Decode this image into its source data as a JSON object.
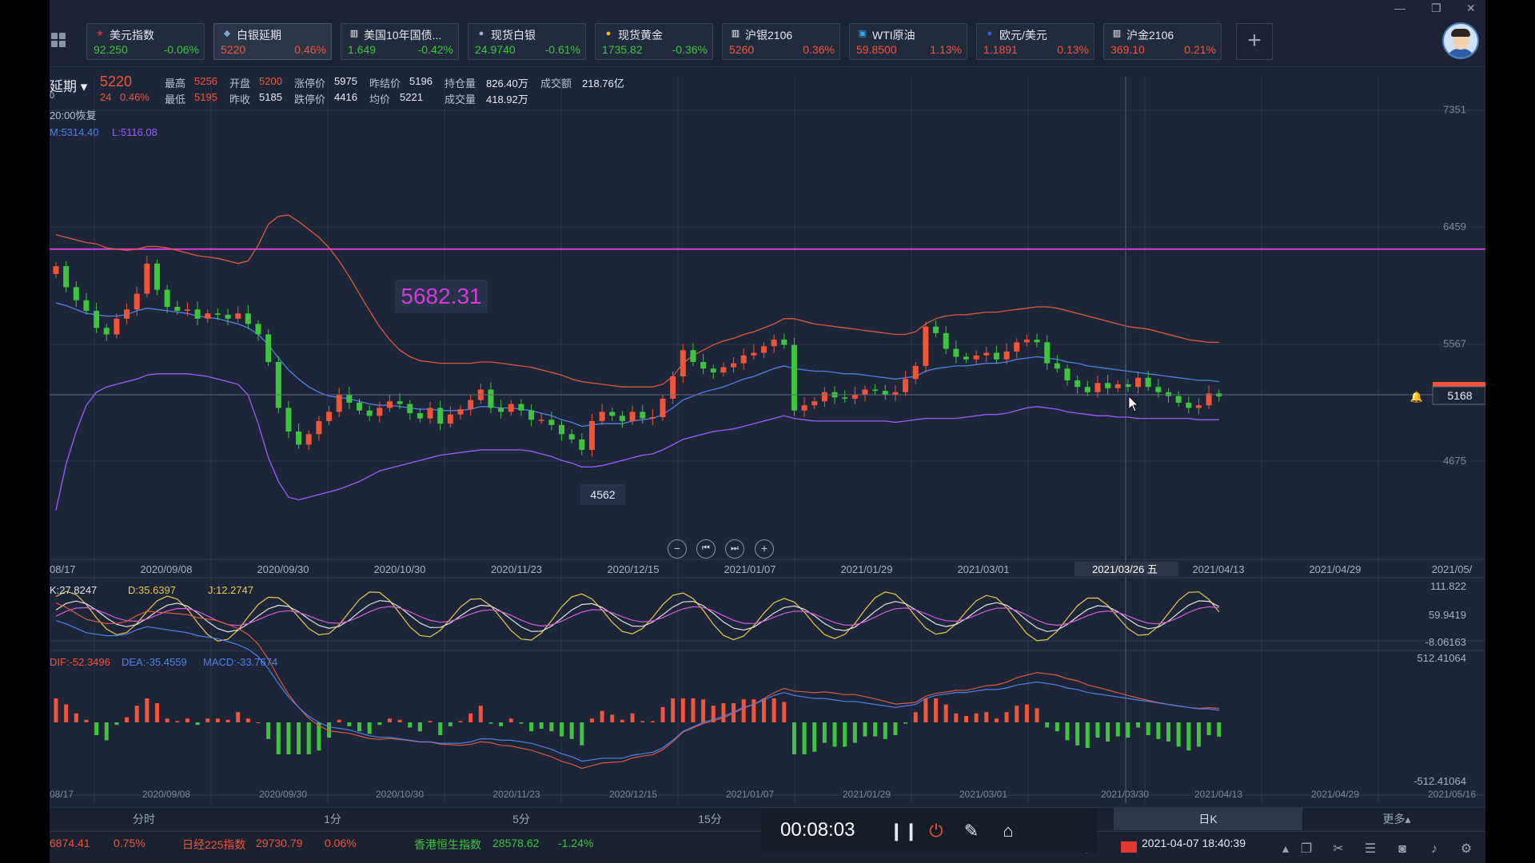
{
  "window": {
    "minimize": "—",
    "restore": "❐",
    "close": "✕"
  },
  "tickers": [
    {
      "name": "美元指数",
      "value": "92.250",
      "change": "-0.06%",
      "dir": "down",
      "icon": "us-flag-icon",
      "glyph": "★",
      "icon_color": "#c0392b"
    },
    {
      "name": "白银延期",
      "value": "5220",
      "change": "0.46%",
      "dir": "up",
      "icon": "silver-ingot-icon",
      "glyph": "◆",
      "icon_color": "#7fa6d6",
      "active": true
    },
    {
      "name": "美国10年国债...",
      "value": "1.649",
      "change": "-0.42%",
      "dir": "down",
      "icon": "bar-chart-icon",
      "glyph": "▥",
      "icon_color": "#ffffff"
    },
    {
      "name": "现货白银",
      "value": "24.9740",
      "change": "-0.61%",
      "dir": "down",
      "icon": "silver-coin-icon",
      "glyph": "●",
      "icon_color": "#9bb3d8"
    },
    {
      "name": "现货黄金",
      "value": "1735.82",
      "change": "-0.36%",
      "dir": "down",
      "icon": "gold-coin-icon",
      "glyph": "●",
      "icon_color": "#e5b93b"
    },
    {
      "name": "沪银2106",
      "value": "5260",
      "change": "0.36%",
      "dir": "up",
      "icon": "bar-chart-icon",
      "glyph": "▥",
      "icon_color": "#ffffff"
    },
    {
      "name": "WTI原油",
      "value": "59.8500",
      "change": "1.13%",
      "dir": "up",
      "icon": "oil-icon",
      "glyph": "▣",
      "icon_color": "#3aa3e6"
    },
    {
      "name": "欧元/美元",
      "value": "1.1891",
      "change": "0.13%",
      "dir": "up",
      "icon": "eu-flag-icon",
      "glyph": "●",
      "icon_color": "#3a5fb8"
    },
    {
      "name": "沪金2106",
      "value": "369.10",
      "change": "0.21%",
      "dir": "up",
      "icon": "bar-chart-icon",
      "glyph": "▥",
      "icon_color": "#ffffff"
    }
  ],
  "add_label": "+",
  "info": {
    "name": "延期 ▾",
    "price": "5220",
    "change": "24",
    "change_pct": "0.46%",
    "sub": "0",
    "high_label": "最高",
    "high": "5256",
    "low_label": "最低",
    "low": "5195",
    "open_label": "开盘",
    "open": "5200",
    "prev_close_label": "昨收",
    "prev_close": "5185",
    "limit_up_label": "涨停价",
    "limit_up": "5975",
    "limit_down_label": "跌停价",
    "limit_down": "4416",
    "prev_settle_label": "昨结价",
    "prev_settle": "5196",
    "avg_label": "均价",
    "avg": "5221",
    "oi_label": "持仓量",
    "oi": "826.40万",
    "volume_label": "成交量",
    "volume": "418.92万",
    "turnover_label": "成交额",
    "turnover": "218.76亿",
    "resume": "20:00恢复",
    "boll": {
      "mid": "M:5314.40",
      "low": "L:5116.08"
    }
  },
  "chart_data": {
    "type": "candlestick",
    "price_axis": [
      "7351",
      "6459",
      "5567",
      "4675"
    ],
    "horizontal_line_value": 6290,
    "current_price_label": "5168",
    "annotation_high": "5682.31",
    "annotation_low": "4562",
    "x_labels": [
      "08/17",
      "2020/09/08",
      "2020/09/30",
      "2020/10/30",
      "2020/11/23",
      "2020/12/15",
      "2021/01/07",
      "2021/01/29",
      "2021/03/01",
      "2021/03/26 五",
      "2021/04/13",
      "2021/04/29",
      "2021/05/"
    ],
    "x_labels_bottom": [
      "08/17",
      "2020/09/08",
      "2020/09/30",
      "2020/10/30",
      "2020/11/23",
      "2020/12/15",
      "2021/01/07",
      "2021/01/29",
      "2021/03/01",
      "2021/03/30",
      "2021/04/13",
      "2021/04/29",
      "2021/05/16"
    ],
    "close": [
      6160,
      6000,
      5900,
      5820,
      5690,
      5640,
      5760,
      5830,
      5950,
      6180,
      5980,
      5850,
      5820,
      5830,
      5760,
      5800,
      5790,
      5760,
      5800,
      5720,
      5640,
      5430,
      5080,
      4900,
      4800,
      4880,
      4980,
      5050,
      5180,
      5120,
      5060,
      5020,
      5080,
      5130,
      5110,
      5040,
      5000,
      5080,
      4960,
      5030,
      5070,
      5140,
      5220,
      5080,
      5050,
      5110,
      5060,
      4990,
      4990,
      4950,
      4880,
      4840,
      4760,
      4980,
      5050,
      5020,
      4980,
      5050,
      5000,
      5010,
      5150,
      5320,
      5520,
      5430,
      5380,
      5350,
      5390,
      5420,
      5480,
      5500,
      5550,
      5600,
      5560,
      5060,
      5100,
      5130,
      5200,
      5160,
      5150,
      5180,
      5220,
      5210,
      5180,
      5200,
      5300,
      5400,
      5700,
      5650,
      5530,
      5470,
      5450,
      5480,
      5500,
      5450,
      5510,
      5580,
      5600,
      5580,
      5420,
      5380,
      5290,
      5240,
      5200,
      5270,
      5230,
      5260,
      5240,
      5310,
      5240,
      5200,
      5170,
      5120,
      5080,
      5100,
      5190,
      5168
    ],
    "boll_mid": [
      5880,
      5860,
      5830,
      5800,
      5790,
      5780,
      5780,
      5790,
      5820,
      5840,
      5830,
      5820,
      5810,
      5800,
      5780,
      5770,
      5760,
      5740,
      5720,
      5690,
      5640,
      5560,
      5460,
      5370,
      5300,
      5240,
      5200,
      5170,
      5160,
      5150,
      5130,
      5110,
      5100,
      5100,
      5090,
      5080,
      5070,
      5070,
      5060,
      5060,
      5060,
      5070,
      5090,
      5090,
      5080,
      5080,
      5070,
      5060,
      5040,
      5020,
      4990,
      4970,
      4940,
      4950,
      4960,
      4960,
      4960,
      4980,
      4990,
      5000,
      5030,
      5080,
      5140,
      5170,
      5200,
      5220,
      5240,
      5270,
      5300,
      5320,
      5350,
      5380,
      5400,
      5380,
      5370,
      5360,
      5360,
      5350,
      5340,
      5340,
      5330,
      5320,
      5310,
      5300,
      5310,
      5320,
      5360,
      5380,
      5390,
      5400,
      5400,
      5410,
      5420,
      5420,
      5430,
      5450,
      5460,
      5470,
      5460,
      5450,
      5430,
      5420,
      5400,
      5390,
      5380,
      5370,
      5360,
      5350,
      5340,
      5330,
      5320,
      5310,
      5300,
      5290,
      5290,
      5280
    ],
    "boll_upper": [
      6400,
      6380,
      6360,
      6340,
      6330,
      6300,
      6290,
      6280,
      6290,
      6310,
      6310,
      6300,
      6280,
      6260,
      6240,
      6230,
      6220,
      6200,
      6180,
      6200,
      6320,
      6480,
      6540,
      6550,
      6500,
      6440,
      6380,
      6300,
      6200,
      6080,
      5950,
      5820,
      5700,
      5600,
      5520,
      5470,
      5440,
      5430,
      5420,
      5420,
      5420,
      5420,
      5430,
      5430,
      5420,
      5410,
      5400,
      5390,
      5370,
      5350,
      5330,
      5300,
      5280,
      5270,
      5260,
      5250,
      5240,
      5240,
      5240,
      5240,
      5260,
      5320,
      5420,
      5480,
      5520,
      5560,
      5590,
      5610,
      5640,
      5660,
      5690,
      5720,
      5760,
      5760,
      5740,
      5720,
      5710,
      5700,
      5690,
      5680,
      5670,
      5660,
      5650,
      5640,
      5640,
      5660,
      5720,
      5760,
      5780,
      5790,
      5790,
      5800,
      5810,
      5810,
      5820,
      5830,
      5840,
      5850,
      5850,
      5840,
      5820,
      5800,
      5780,
      5760,
      5740,
      5720,
      5700,
      5690,
      5680,
      5660,
      5640,
      5620,
      5600,
      5590,
      5580,
      5580
    ],
    "boll_lower": [
      4300,
      4650,
      4900,
      5100,
      5200,
      5240,
      5260,
      5280,
      5300,
      5330,
      5340,
      5340,
      5340,
      5340,
      5330,
      5320,
      5300,
      5280,
      5260,
      5180,
      4960,
      4700,
      4520,
      4400,
      4380,
      4400,
      4420,
      4440,
      4460,
      4490,
      4520,
      4560,
      4600,
      4620,
      4640,
      4660,
      4680,
      4700,
      4720,
      4730,
      4740,
      4750,
      4760,
      4760,
      4760,
      4760,
      4760,
      4750,
      4730,
      4710,
      4680,
      4660,
      4630,
      4630,
      4640,
      4660,
      4680,
      4700,
      4720,
      4730,
      4760,
      4800,
      4840,
      4860,
      4880,
      4900,
      4910,
      4920,
      4940,
      4960,
      4980,
      5000,
      5020,
      5000,
      4990,
      4980,
      4980,
      4980,
      4980,
      4980,
      4980,
      4980,
      4980,
      4970,
      4980,
      4990,
      5000,
      5000,
      5000,
      5000,
      5010,
      5020,
      5030,
      5030,
      5040,
      5060,
      5080,
      5090,
      5080,
      5070,
      5050,
      5040,
      5030,
      5020,
      5020,
      5010,
      5010,
      5000,
      5000,
      5000,
      5000,
      5000,
      5000,
      4990,
      4990,
      4990
    ],
    "kdj": {
      "k_label": "K:27.8247",
      "d_label": "D:35.6397",
      "j_label": "J:12.2747",
      "axis": [
        "111.822",
        "59.9419",
        "-8.06163"
      ]
    },
    "macd": {
      "dif_label": "DIF:-52.3496",
      "dea_label": "DEA:-35.4559",
      "macd_label": "MACD:-33.7674",
      "axis": [
        "512.41064",
        "-512.41064"
      ]
    },
    "colors": {
      "up": "#f2543a",
      "down": "#3fc43f",
      "mid": "#4f7fe8",
      "upper": "#d9593d",
      "lower": "#9b5cff",
      "hline": "#d43bd8",
      "k": "#e0e0e0",
      "d": "#e5c84a",
      "j": "#d35cd8"
    }
  },
  "tabs": [
    "分时",
    "1分",
    "5分",
    "15分",
    "",
    "",
    "日K",
    "更多▴"
  ],
  "recorder": {
    "time": "00:08:03"
  },
  "statusbar": {
    "idx1_value": "6874.41",
    "idx1_change": "0.75%",
    "nikkei_name": "日经225指数",
    "nikkei_value": "29730.79",
    "nikkei_change": "0.06%",
    "hsi_name": "香港恒生指数",
    "hsi_value": "28578.62",
    "hsi_change": "-1.24%",
    "datetime": "2021-04-07 18:40:39"
  }
}
